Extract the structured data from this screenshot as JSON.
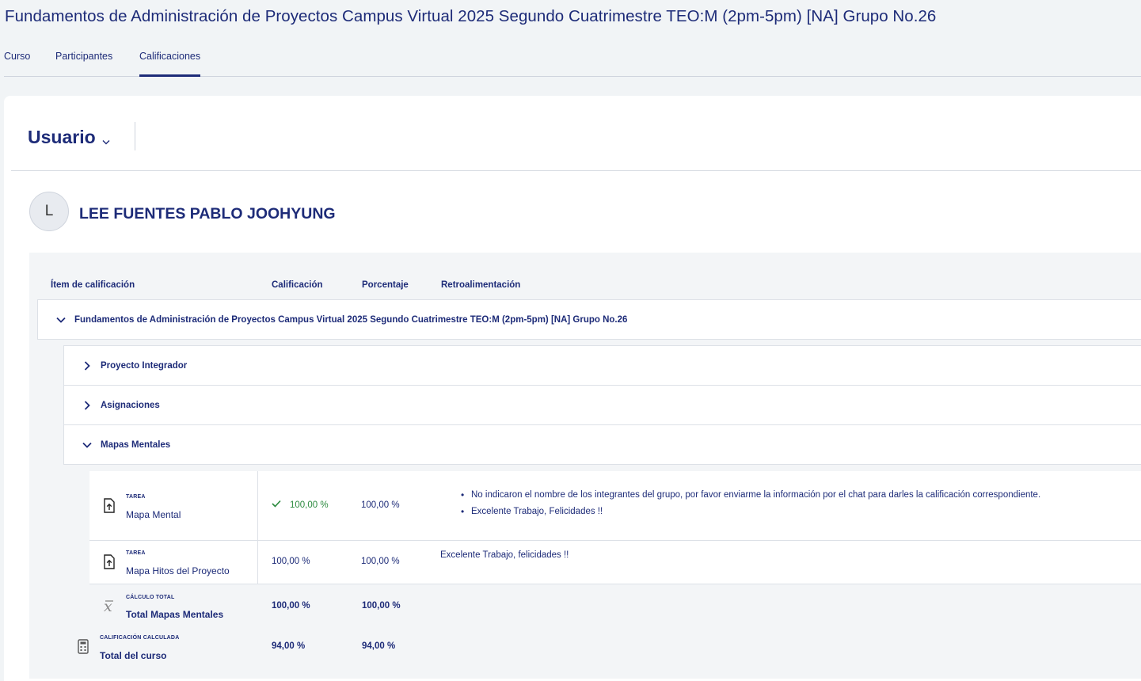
{
  "course": {
    "title": "Fundamentos de Administración de Proyectos Campus Virtual 2025 Segundo Cuatrimestre TEO:M (2pm-5pm) [NA] Grupo No.26"
  },
  "nav": {
    "tabs": [
      {
        "label": "Curso"
      },
      {
        "label": "Participantes"
      },
      {
        "label": "Calificaciones",
        "active": true
      }
    ]
  },
  "selector": {
    "label": "Usuario"
  },
  "user": {
    "initial": "L",
    "name": "LEE FUENTES PABLO JOOHYUNG"
  },
  "table": {
    "headers": {
      "item": "Ítem de calificación",
      "grade": "Calificación",
      "percentage": "Porcentaje",
      "feedback": "Retroalimentación"
    },
    "course_category": "Fundamentos de Administración de Proyectos Campus Virtual 2025 Segundo Cuatrimestre TEO:M (2pm-5pm) [NA] Grupo No.26",
    "categories": [
      {
        "label": "Proyecto Integrador",
        "expanded": false
      },
      {
        "label": "Asignaciones",
        "expanded": false
      },
      {
        "label": "Mapas Mentales",
        "expanded": true
      }
    ],
    "items": [
      {
        "type": "TAREA",
        "name": "Mapa Mental",
        "grade": "100,00 %",
        "percentage": "100,00 %",
        "feedback": [
          "No indicaron el nombre de los integrantes del grupo, por favor enviarme la información por el chat para darles la calificación correspondiente.",
          "Excelente Trabajo, Felicidades !!"
        ],
        "icon": "assignment-icon"
      },
      {
        "type": "TAREA",
        "name": "Mapa Hitos del Proyecto",
        "grade": "100,00 %",
        "percentage": "100,00 %",
        "feedback_text": "Excelente Trabajo, felicidades !!",
        "icon": "assignment-icon"
      }
    ],
    "category_total": {
      "type": "CÁLCULO TOTAL",
      "name": "Total Mapas Mentales",
      "grade": "100,00 %",
      "percentage": "100,00 %",
      "icon": "calculation-icon"
    },
    "course_total": {
      "type": "CALIFICACIÓN CALCULADA",
      "name": "Total del curso",
      "grade": "94,00 %",
      "percentage": "94,00 %",
      "icon": "calculator-icon"
    }
  },
  "colors": {
    "primary": "#1d2b78",
    "success": "#2b8a3e",
    "page_bg": "#f1f4f6"
  }
}
